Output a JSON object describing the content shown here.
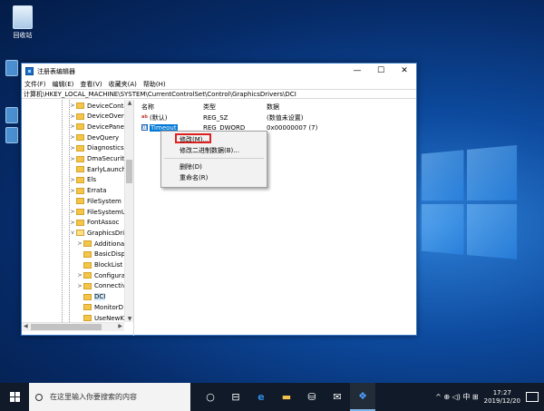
{
  "desktop": {
    "recycle_label": "回收站"
  },
  "window": {
    "title": "注册表编辑器",
    "controls": {
      "minimize": "—",
      "maximize": "☐",
      "close": "✕"
    },
    "menu": [
      "文件(F)",
      "编辑(E)",
      "查看(V)",
      "收藏夹(A)",
      "帮助(H)"
    ],
    "address": "计算机\\HKEY_LOCAL_MACHINE\\SYSTEM\\CurrentControlSet\\Control\\GraphicsDrivers\\DCI"
  },
  "tree": [
    {
      "label": "DeviceContai",
      "expander": ">",
      "open": false,
      "selected": false
    },
    {
      "label": "DeviceOverri",
      "expander": ">",
      "open": false,
      "selected": false
    },
    {
      "label": "DevicePanels",
      "expander": ">",
      "open": false,
      "selected": false
    },
    {
      "label": "DevQuery",
      "expander": ">",
      "open": false,
      "selected": false
    },
    {
      "label": "Diagnostics",
      "expander": ">",
      "open": false,
      "selected": false
    },
    {
      "label": "DmaSecurity",
      "expander": ">",
      "open": false,
      "selected": false
    },
    {
      "label": "EarlyLaunch",
      "expander": "",
      "open": false,
      "selected": false
    },
    {
      "label": "Els",
      "expander": ">",
      "open": false,
      "selected": false
    },
    {
      "label": "Errata",
      "expander": ">",
      "open": false,
      "selected": false
    },
    {
      "label": "FileSystem",
      "expander": "",
      "open": false,
      "selected": false
    },
    {
      "label": "FileSystemUti",
      "expander": ">",
      "open": false,
      "selected": false
    },
    {
      "label": "FontAssoc",
      "expander": ">",
      "open": false,
      "selected": false
    },
    {
      "label": "GraphicsDriv",
      "expander": "v",
      "open": true,
      "selected": false
    },
    {
      "label": "Additional",
      "expander": ">",
      "open": false,
      "selected": false,
      "child": true
    },
    {
      "label": "BasicDispl",
      "expander": "",
      "open": false,
      "selected": false,
      "child": true
    },
    {
      "label": "BlockList",
      "expander": "",
      "open": false,
      "selected": false,
      "child": true
    },
    {
      "label": "Configurat",
      "expander": ">",
      "open": false,
      "selected": false,
      "child": true
    },
    {
      "label": "Connectivi",
      "expander": ">",
      "open": false,
      "selected": false,
      "child": true
    },
    {
      "label": "DCI",
      "expander": "",
      "open": false,
      "selected": true,
      "child": true
    },
    {
      "label": "MonitorD",
      "expander": "",
      "open": false,
      "selected": false,
      "child": true
    },
    {
      "label": "UseNewKe",
      "expander": "",
      "open": false,
      "selected": false,
      "child": true
    }
  ],
  "columns": {
    "name": "名称",
    "type": "类型",
    "data": "数据"
  },
  "values": [
    {
      "name": "(默认)",
      "type": "REG_SZ",
      "data": "(数值未设置)",
      "icon": "ab"
    },
    {
      "name": "Timeout",
      "type": "REG_DWORD",
      "data": "0x00000007 (7)",
      "icon": "bin"
    }
  ],
  "context_menu": [
    "修改(M)...",
    "修改二进制数据(B)...",
    "删除(D)",
    "重命名(R)"
  ],
  "taskbar": {
    "search_placeholder": "在这里输入你要搜索的内容",
    "tray_text": "^ ⊕ ◁) 中 ⊞",
    "time": "17:27",
    "date": "2019/12/20"
  },
  "colors": {
    "accent": "#0078d7",
    "highlight_box": "#e02020"
  }
}
